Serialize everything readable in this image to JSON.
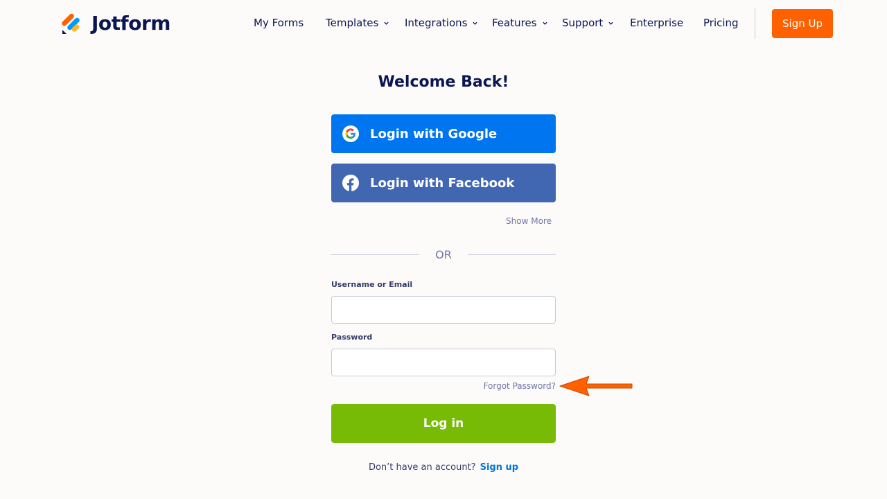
{
  "brand": {
    "name": "Jotform",
    "colors": {
      "accent": "#ff6100",
      "primary_blue": "#0075f0",
      "facebook_blue": "#4267b2",
      "login_green": "#78bb07",
      "navy": "#0a1551"
    }
  },
  "nav": {
    "items": [
      {
        "label": "My Forms",
        "dropdown": false
      },
      {
        "label": "Templates",
        "dropdown": true
      },
      {
        "label": "Integrations",
        "dropdown": true
      },
      {
        "label": "Features",
        "dropdown": true
      },
      {
        "label": "Support",
        "dropdown": true
      },
      {
        "label": "Enterprise",
        "dropdown": false
      },
      {
        "label": "Pricing",
        "dropdown": false
      }
    ],
    "signup_label": "Sign Up"
  },
  "login": {
    "title": "Welcome Back!",
    "google_label": "Login with Google",
    "facebook_label": "Login with Facebook",
    "show_more": "Show More",
    "divider_text": "OR",
    "username_label": "Username or Email",
    "username_value": "",
    "password_label": "Password",
    "password_value": "",
    "forgot_label": "Forgot Password?",
    "submit_label": "Log in",
    "no_account_text": "Don’t have an account?",
    "signup_link": "Sign up"
  },
  "icons": [
    "jotform-logo-icon",
    "chevron-down-icon",
    "google-icon",
    "facebook-icon",
    "annotation-arrow-icon"
  ]
}
